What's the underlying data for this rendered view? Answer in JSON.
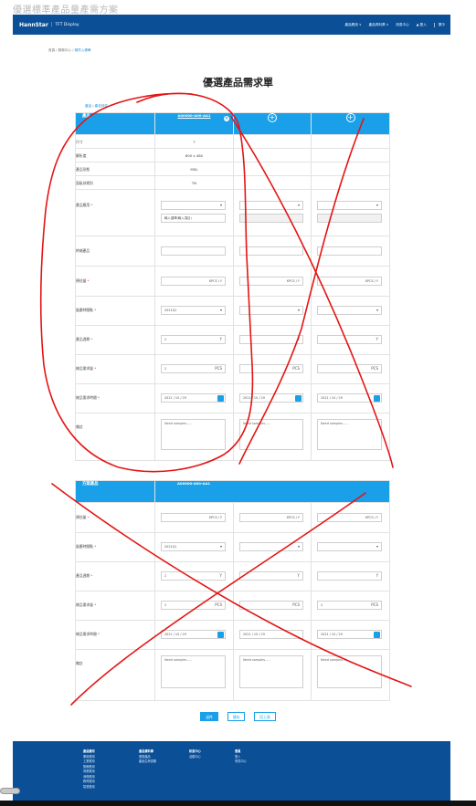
{
  "caption": "優選標準產品量產需方案",
  "header": {
    "brand": "HannStar",
    "brand_sub": "TFT Display",
    "nav": [
      "產品應用 ∨",
      "產品資料庫 ∨",
      "訊息中心"
    ],
    "login": "▲ 登入",
    "lang": "繁中"
  },
  "breadcrumb": {
    "path": "首頁 / 服務中心 / ",
    "current": "銷貨入帳單"
  },
  "title": "優選產品需求單",
  "sub_tabs": "產品 | 產品評估",
  "section1": {
    "head_label": "產品",
    "code": "A00000-A00-AA1",
    "close_glyph": "×",
    "plus_glyph": "+",
    "spec_rows": [
      {
        "label": "尺寸",
        "value": "7"
      },
      {
        "label": "解析度",
        "value": "800 x 480"
      },
      {
        "label": "產品形態",
        "value": "MDL"
      },
      {
        "label": "面板技術別",
        "value": "TN"
      }
    ],
    "labels": {
      "application": "產品應用",
      "terminal": "終端產品",
      "forecast": "預估量",
      "mp_time": "量產時間點",
      "cycle": "產品週期",
      "sample_qty": "樣品需求量",
      "sample_date": "樣品需求時間",
      "remark": "備註"
    },
    "required_mark": " *",
    "app_hint": "輸入選擇(輸入項目)",
    "unit_kpcs": "KPCS / Y",
    "mp_value": "2021Q1",
    "cycle_value": "2",
    "cycle_unit": "Y",
    "pcs_value": "2",
    "pcs_unit": "PCS",
    "date_value": "2021 / 10 / 29",
    "remark_placeholder": "Need samples......"
  },
  "section2": {
    "head_label": "方案產品",
    "code": "A00000-A00-AA1",
    "labels": {
      "forecast": "預估量",
      "mp_time": "量產時間點",
      "cycle": "產品週期",
      "sample_qty": "樣品需求量",
      "sample_date": "樣品需求時間",
      "remark": "備註"
    }
  },
  "buttons": {
    "submit": "送件",
    "save": "儲存",
    "prev": "回上頁"
  },
  "footer": [
    {
      "head": "產品應用",
      "items": [
        "車用應用",
        "工業應用",
        "醫療應用",
        "商業應用",
        "消費應用",
        "教育應用",
        "智慧應用"
      ]
    },
    {
      "head": "產品資料庫",
      "items": [
        "優選產品",
        "產品生命週期"
      ]
    },
    {
      "head": "訊息中心",
      "items": [
        "活動中心"
      ]
    },
    {
      "head": "會員",
      "items": [
        "登入",
        "會員中心"
      ]
    }
  ],
  "colors": {
    "brand": "#0b4f96",
    "accent": "#1aa0e8",
    "scribble": "#e41414"
  }
}
